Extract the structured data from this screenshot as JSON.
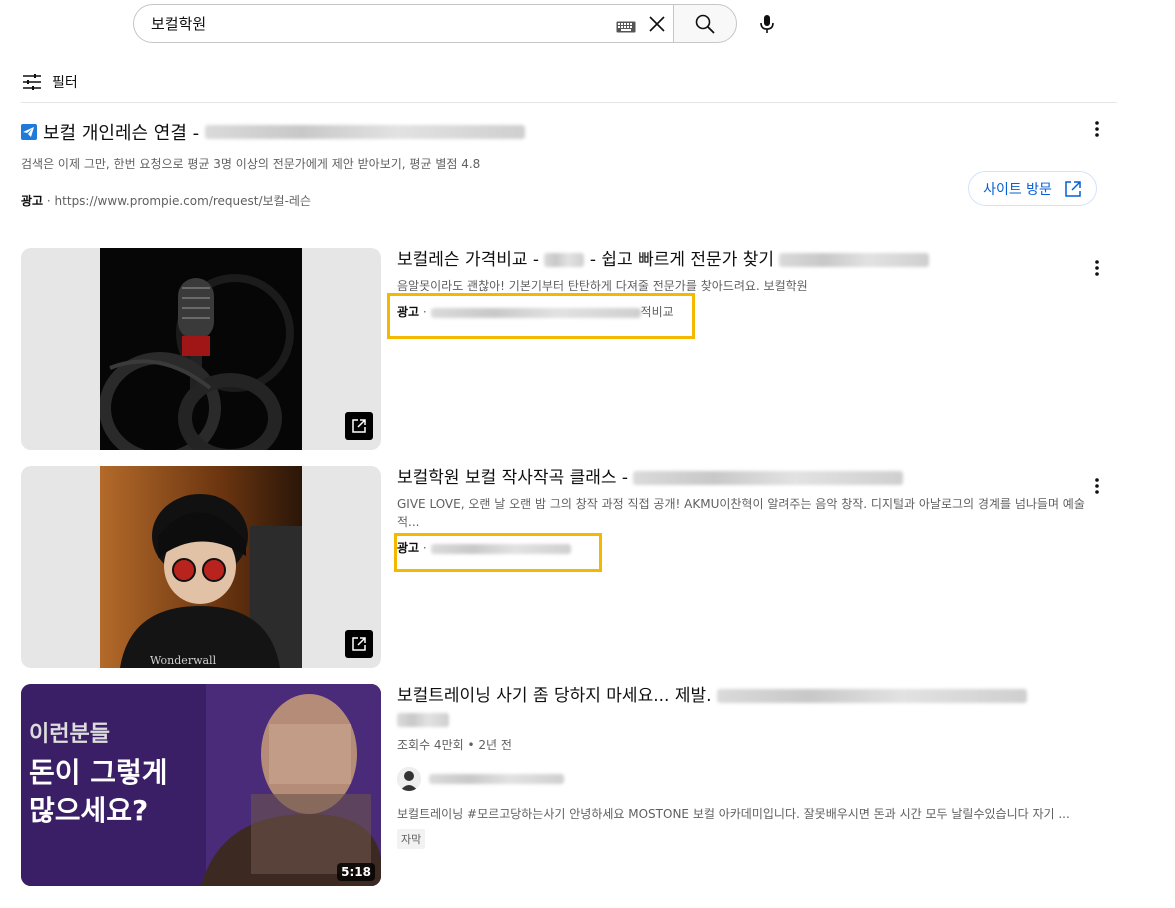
{
  "search": {
    "query": "보컬학원"
  },
  "filter": {
    "label": "필터"
  },
  "top_ad": {
    "title": "보컬 개인레슨 연결 -",
    "description": "검색은 이제 그만, 한번 요청으로 평균 3명 이상의 전문가에게 제안 받아보기, 평균 별점 4.8",
    "ad_label": "광고",
    "url": "https://www.prompie.com/request/보컬-레슨",
    "visit_label": "사이트 방문"
  },
  "results": [
    {
      "title": "보컬레슨 가격비교 -",
      "title_mid": " - 쉽고 빠르게 전문가 찾기",
      "description": "음알못이라도 괜찮아! 기본기부터 탄탄하게 다져줄 전문가를 찾아드려요. 보컬학원",
      "ad_label": "광고",
      "url_tail": "적비교"
    },
    {
      "title": "보컬학원 보컬 작사작곡 클래스 -",
      "description": "GIVE LOVE, 오랜 날 오랜 밤 그의 창작 과정 직접 공개! AKMU이찬혁이 알려주는 음악 창작. 디지털과 아날로그의 경계를 넘나들며 예술적...",
      "ad_label": "광고",
      "thumb_text": "Wonderwall"
    },
    {
      "title": "보컬트레이닝 사기 좀 당하지 마세요... 제발.",
      "meta": "조회수 4만회 • 2년 전",
      "description": "보컬트레이닝 #모르고당하는사기 안녕하세요 MOSTONE 보컬 아카데미입니다. 잘못배우시면 돈과 시간 모두 날릴수있습니다 자기 ...",
      "badge": "자막",
      "duration": "5:18",
      "thumb_lines": [
        "이런분들",
        "돈이 그렇게",
        "많으세요?"
      ]
    }
  ],
  "colors": {
    "highlight": "#f4b800",
    "link_blue": "#065fd4",
    "thumb_purple": "#3b1f66"
  }
}
